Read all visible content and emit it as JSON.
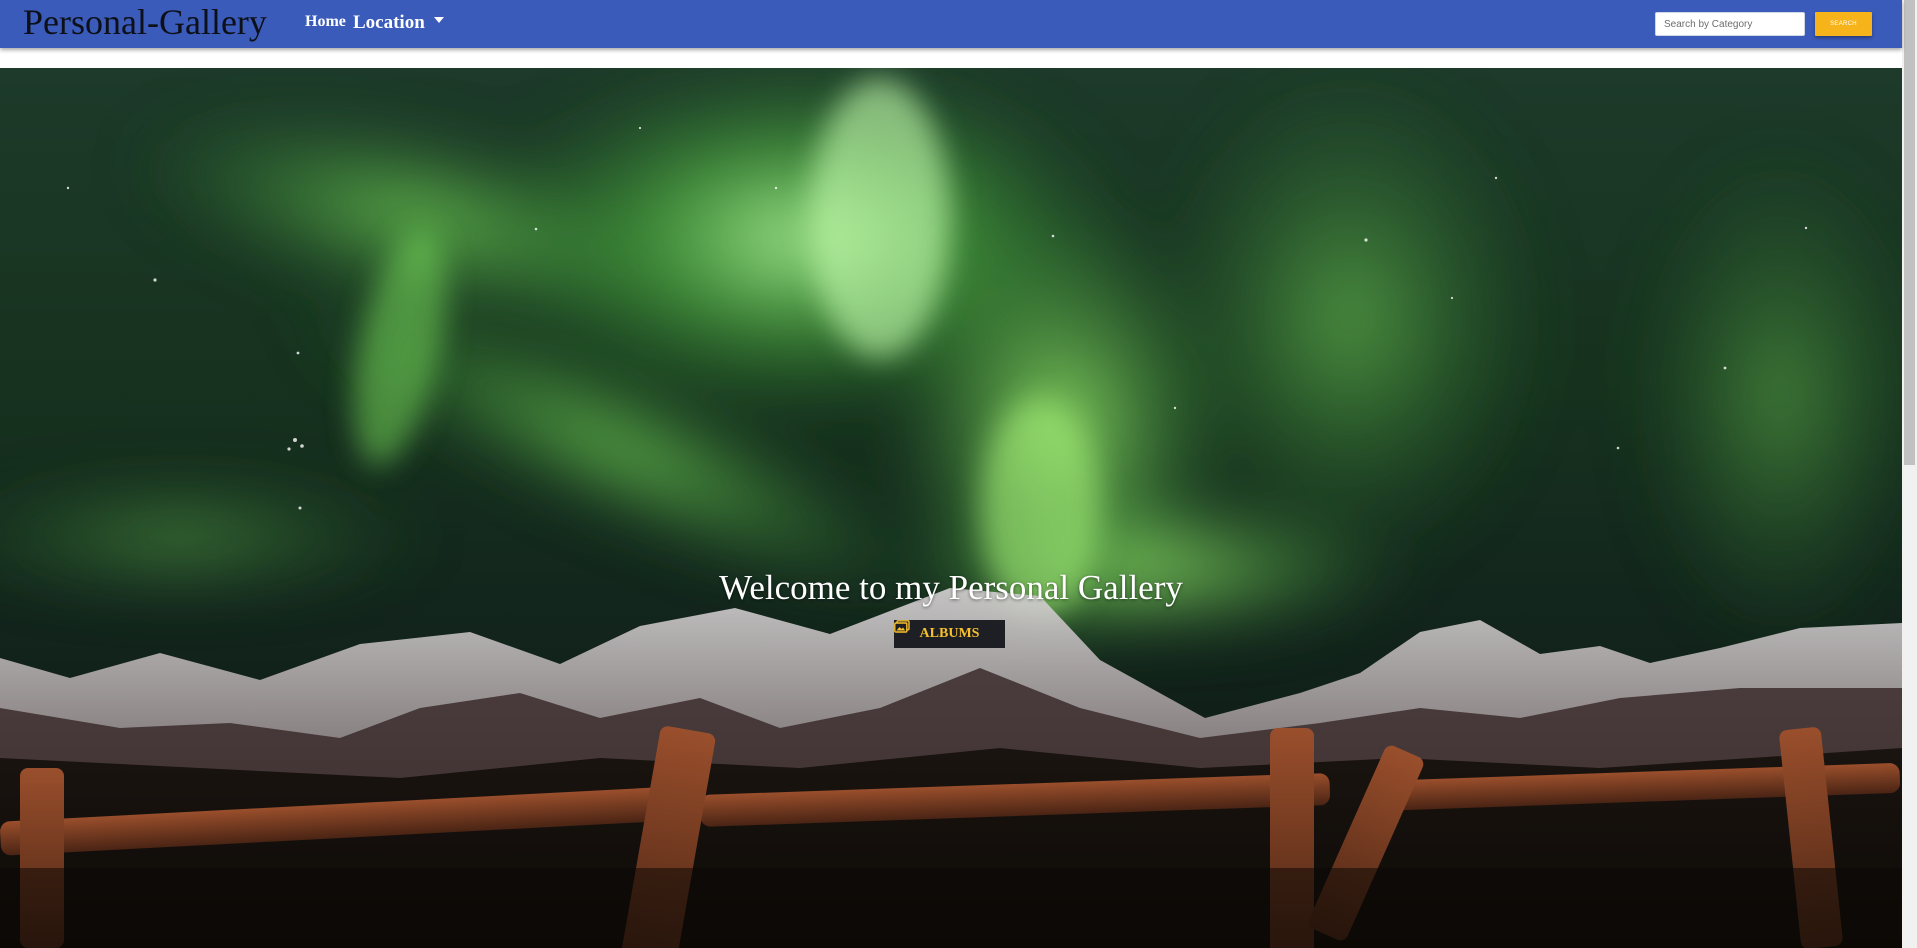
{
  "navbar": {
    "brand": "Personal-Gallery",
    "home_label": "Home",
    "location_label": "Location",
    "search_placeholder": "Search by Category",
    "search_button_label": "SEARCH",
    "background_color": "#3a5bb9",
    "accent_color": "#f6b41a"
  },
  "hero": {
    "title": "Welcome to my Personal Gallery",
    "albums_button_label": "ALBUMS",
    "albums_icon": "images-icon",
    "background_image": "aurora-borealis-over-snowy-mountains-and-wooden-fence"
  }
}
